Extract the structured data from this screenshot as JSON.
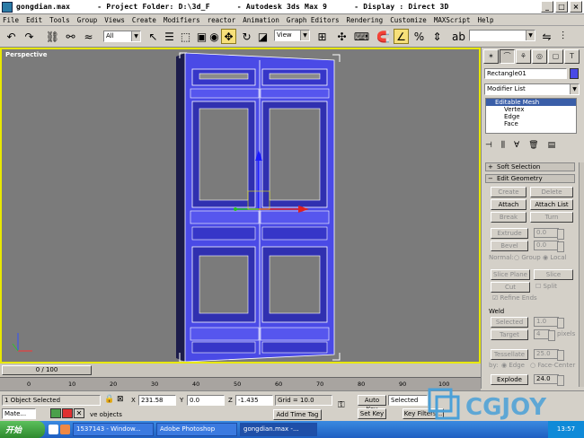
{
  "window": {
    "title": "gongdian.max      - Project Folder: D:\\3d_F      - Autodesk 3ds Max 9      - Display : Direct 3D"
  },
  "menu": [
    "File",
    "Edit",
    "Tools",
    "Group",
    "Views",
    "Create",
    "Modifiers",
    "reactor",
    "Animation",
    "Graph Editors",
    "Rendering",
    "Customize",
    "MAXScript",
    "Help"
  ],
  "toolbar": {
    "selection_filter": "All",
    "ref_coord": "View",
    "named_selection": ""
  },
  "viewport": {
    "label": "Perspective",
    "object_color": "#4a4ae6"
  },
  "command_panel": {
    "object_name": "Rectangle01",
    "object_color": "#4a4ae6",
    "modifier_list": "Modifier List",
    "stack": {
      "top": "Editable Mesh",
      "items": [
        "Vertex",
        "Edge",
        "Face"
      ]
    },
    "soft_selection": "Soft Selection",
    "edit_geometry": {
      "title": "Edit Geometry",
      "create": "Create",
      "delete": "Delete",
      "attach": "Attach",
      "attach_list": "Attach List",
      "break": "Break",
      "turn": "Turn",
      "extrude": "Extrude",
      "extrude_val": "0.0",
      "bevel": "Bevel",
      "bevel_val": "0.0",
      "normal": "Normal:",
      "group": "Group",
      "local": "Local",
      "slice_plane": "Slice Plane",
      "slice": "Slice",
      "cut": "Cut",
      "split": "Split",
      "refine_ends": "Refine Ends",
      "weld": "Weld",
      "selected": "Selected",
      "selected_val": "1.0",
      "target": "Target",
      "target_val": "4",
      "pixels": "pixels",
      "tessellate": "Tessellate",
      "tessellate_val": "25.0",
      "by": "by:",
      "edge": "Edge",
      "face_center": "Face-Center",
      "explode": "Explode",
      "explode_val": "24.0"
    }
  },
  "timeline": {
    "slider": "0 / 100",
    "ticks": [
      "0",
      "10",
      "20",
      "30",
      "40",
      "50",
      "60",
      "70",
      "80",
      "90",
      "100"
    ]
  },
  "status": {
    "selection": "1 Object Selected",
    "x": "231.58",
    "y": "0.0",
    "z": "-1.435",
    "grid": "Grid = 10.0",
    "prompt": "ve objects",
    "add_time_tag": "Add Time Tag",
    "auto_key": "Auto Key",
    "selected": "Selected",
    "set_key": "Set Key",
    "key_filters": "Key Filters...",
    "script_prefix": "Mate..."
  },
  "taskbar": {
    "start": "开始",
    "tasks": [
      "1537143 - Window...",
      "Adobe Photoshop",
      "gongdian.max -..."
    ],
    "clock": "13:57"
  },
  "watermark": "CGJOY"
}
